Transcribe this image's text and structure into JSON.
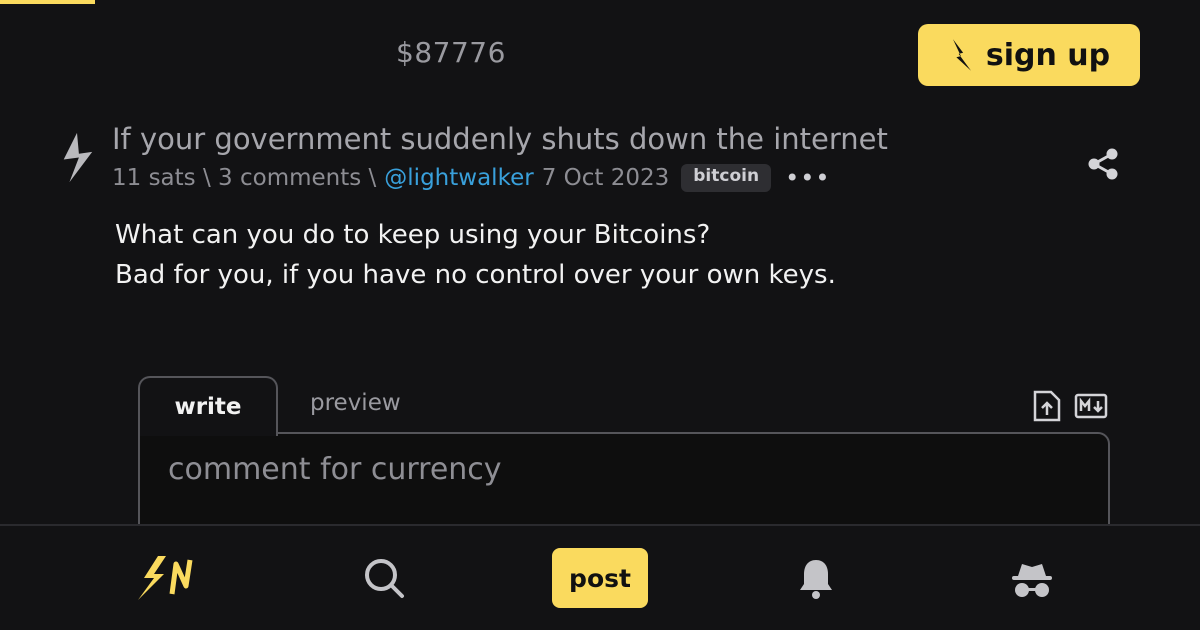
{
  "header": {
    "price": "$87776",
    "signup_label": "sign up"
  },
  "item": {
    "title": "If your government suddenly shuts down the internet",
    "meta_prefix": "11 sats \\ 3 comments \\",
    "user": "@lightwalker",
    "date": "7 Oct 2023",
    "badge": "bitcoin",
    "more": "•••",
    "body_line1": "What can you do to keep using your Bitcoins?",
    "body_line2": "Bad for you, if you have no control over your own keys."
  },
  "editor": {
    "tab_write": "write",
    "tab_preview": "preview",
    "placeholder": "comment for currency"
  },
  "nav": {
    "post_label": "post"
  },
  "colors": {
    "accent": "#fada5e",
    "link": "#39a0db",
    "background": "#121214"
  },
  "icons": {
    "signup": "bolt-icon",
    "item": "bolt-icon",
    "share": "share-icon",
    "upload": "upload-icon",
    "markdown": "markdown-icon",
    "logo": "sn-logo-icon",
    "search": "search-icon",
    "notifications": "bell-icon",
    "anon": "anon-icon"
  }
}
